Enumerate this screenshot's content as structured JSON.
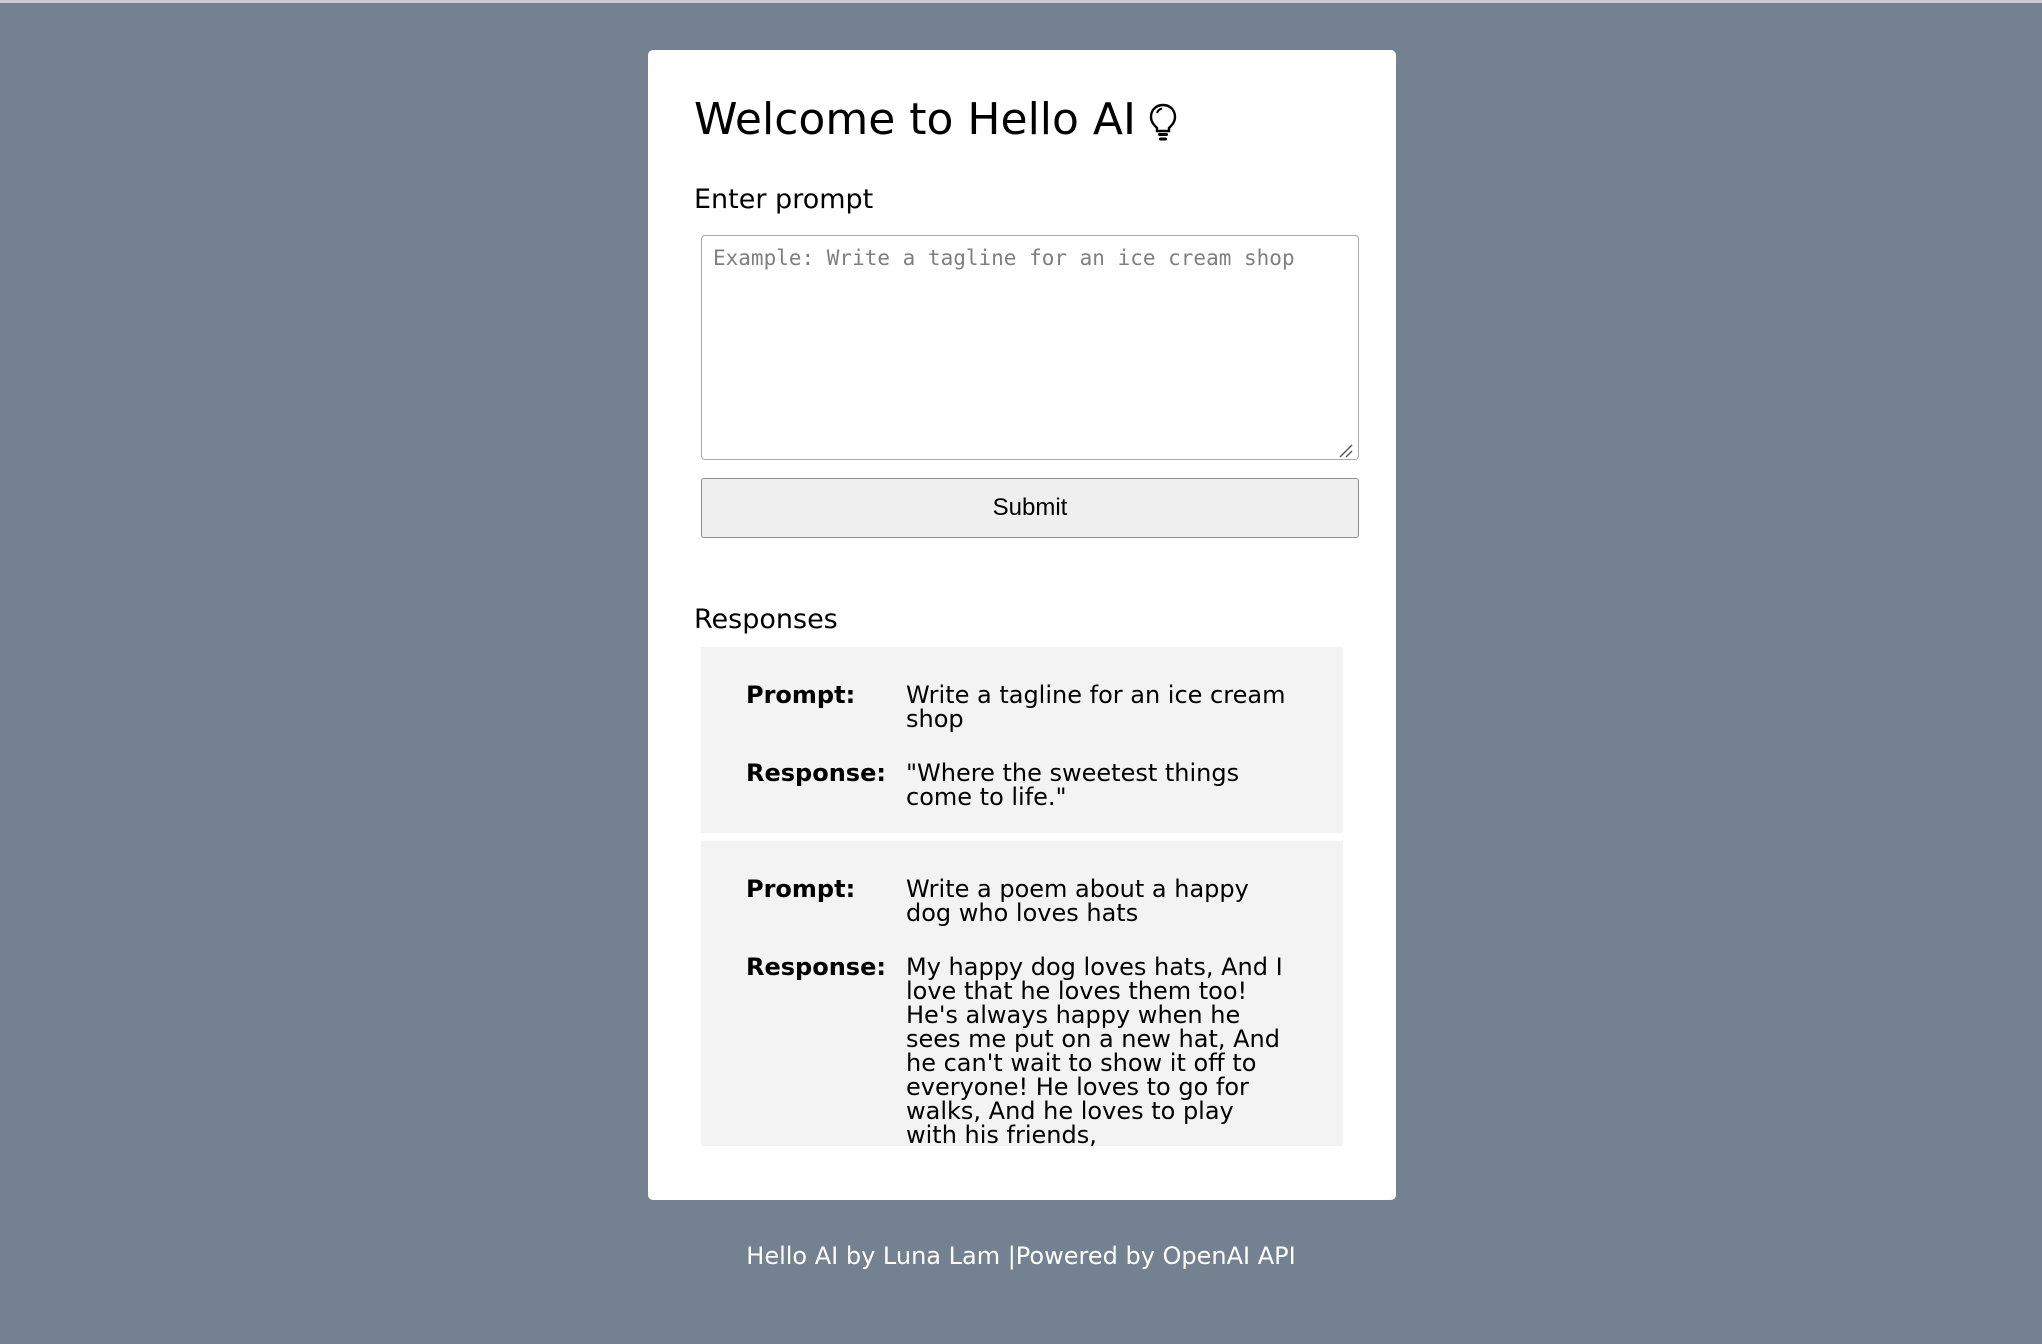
{
  "header": {
    "title": "Welcome to Hello AI",
    "icon": "lightbulb-icon"
  },
  "form": {
    "label": "Enter prompt",
    "placeholder": "Example: Write a tagline for an ice cream shop",
    "value": "",
    "submit_label": "Submit"
  },
  "responses": {
    "heading": "Responses",
    "prompt_label": "Prompt:",
    "response_label": "Response:",
    "items": [
      {
        "prompt": "Write a tagline for an ice cream shop",
        "response": "\"Where the sweetest things come to life.\""
      },
      {
        "prompt": "Write a poem about a happy dog who loves hats",
        "response": "My happy dog loves hats, And I love that he loves them too! He's always happy when he sees me put on a new hat, And he can't wait to show it off to everyone! He loves to go for walks, And he loves to play with his friends,"
      }
    ]
  },
  "footer": {
    "text": "Hello AI by Luna Lam |Powered by OpenAI API"
  },
  "colors": {
    "background": "#738190",
    "card": "#ffffff",
    "response_bg": "#f3f3f3",
    "button_bg": "#efefef"
  }
}
